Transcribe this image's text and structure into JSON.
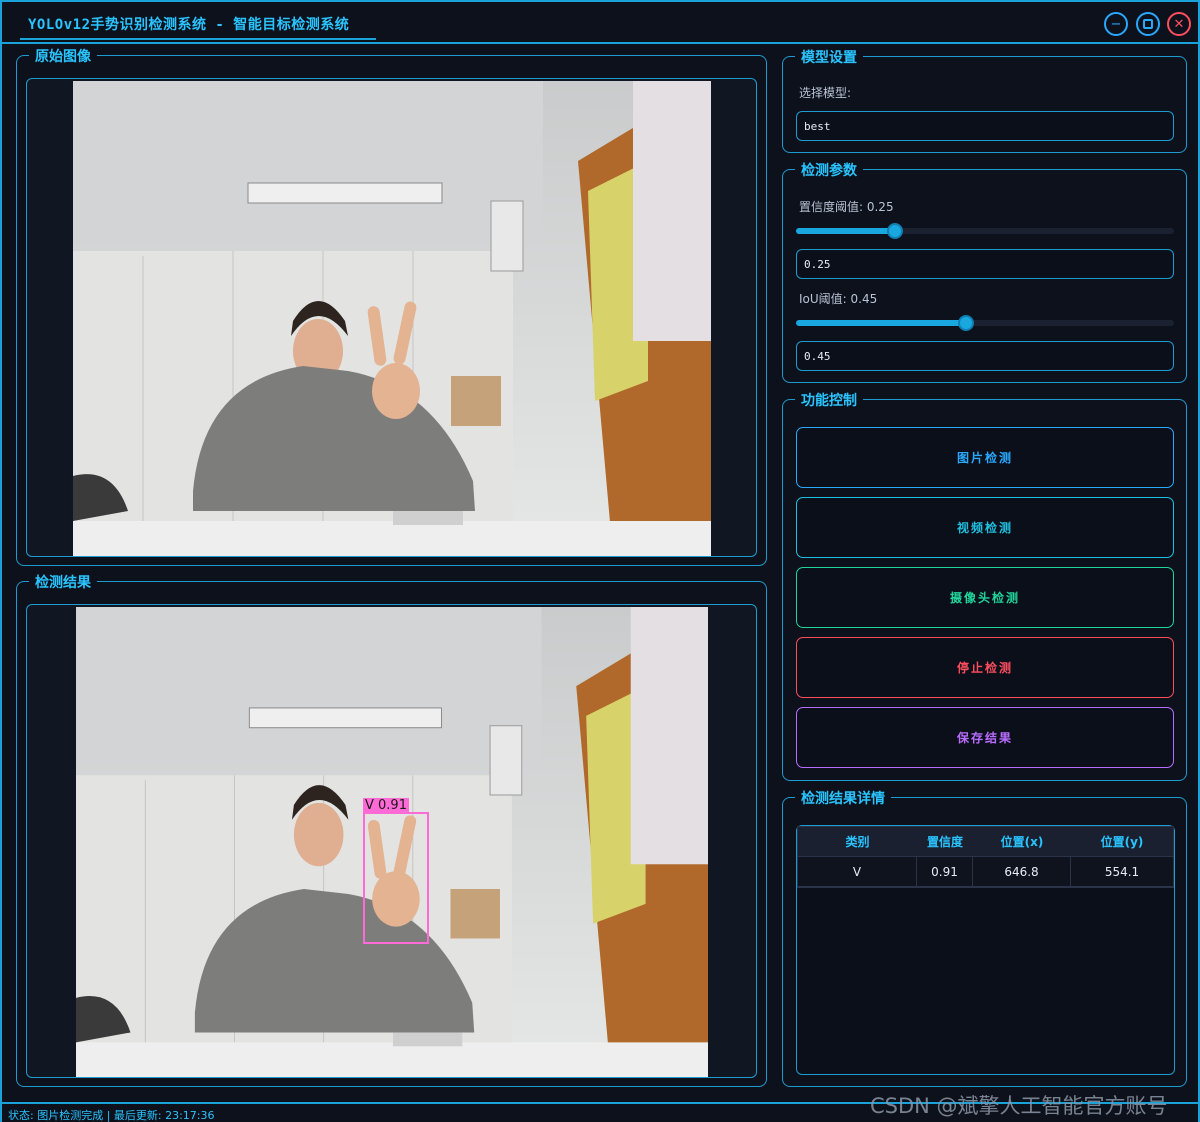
{
  "window": {
    "title": "YOLOv12手势识别检测系统 - 智能目标检测系统",
    "buttons": {
      "minimize_icon": "minimize-icon",
      "maximize_icon": "maximize-icon",
      "close_icon": "close-icon"
    }
  },
  "left": {
    "original_title": "原始图像",
    "result_title": "检测结果",
    "detection_box": {
      "label": "V 0.91",
      "color": "#ff5cd6"
    }
  },
  "model": {
    "group_title": "模型设置",
    "select_label": "选择模型:",
    "select_value": "best"
  },
  "params": {
    "group_title": "检测参数",
    "conf_label": "置信度阈值: 0.25",
    "conf_value": 0.25,
    "conf_field": "0.25",
    "iou_label": "IoU阈值: 0.45",
    "iou_value": 0.45,
    "iou_field": "0.45"
  },
  "controls": {
    "group_title": "功能控制",
    "image_detect": "图片检测",
    "video_detect": "视频检测",
    "camera_detect": "摄像头检测",
    "stop_detect": "停止检测",
    "save_result": "保存结果",
    "colors": {
      "image": "#29a8ff",
      "video": "#1ec0e0",
      "camera": "#20d49a",
      "stop": "#ff4d5e",
      "save": "#b86bff"
    }
  },
  "results": {
    "group_title": "检测结果详情",
    "columns": [
      "类别",
      "置信度",
      "位置(x)",
      "位置(y)"
    ],
    "rows": [
      [
        "V",
        "0.91",
        "646.8",
        "554.1"
      ]
    ]
  },
  "status": {
    "text": "状态: 图片检测完成 | 最后更新: 23:17:36"
  },
  "watermark": "CSDN @斌擎人工智能官方账号"
}
